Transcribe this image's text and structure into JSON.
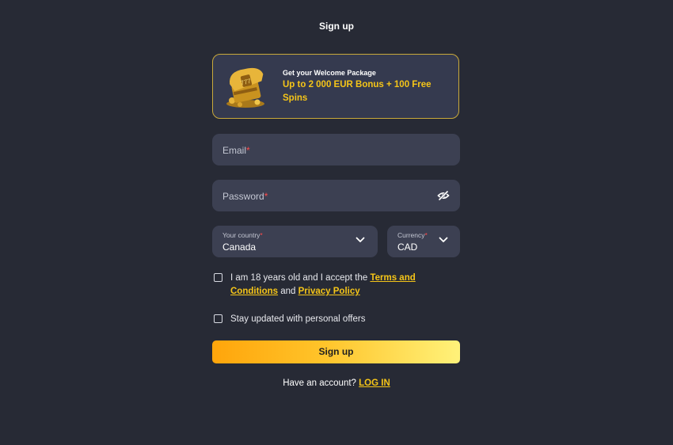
{
  "header": {
    "title": "Sign up"
  },
  "promo": {
    "subtitle": "Get your Welcome Package",
    "offer": "Up to 2 000 EUR Bonus + 100 Free Spins",
    "image_icon": "treasure-chest-icon"
  },
  "form": {
    "email": {
      "label": "Email",
      "required_mark": "*"
    },
    "password": {
      "label": "Password",
      "required_mark": "*",
      "toggle_icon": "eye-off-icon"
    },
    "country": {
      "label": "Your country",
      "required_mark": "*",
      "value": "Canada"
    },
    "currency": {
      "label": "Currency",
      "required_mark": "*",
      "value": "CAD"
    },
    "terms": {
      "text_before": "I am 18 years old and I accept the ",
      "terms_link": "Terms and Conditions",
      "text_middle": " and ",
      "privacy_link": "Privacy Policy",
      "checked": false
    },
    "offers": {
      "text": "Stay updated with personal offers",
      "checked": false
    },
    "submit_label": "Sign up"
  },
  "footer": {
    "question": "Have an account?",
    "login_link": "LOG IN"
  },
  "colors": {
    "background": "#272a35",
    "field": "#3c4052",
    "accent": "#f5c518",
    "required": "#ff4a4a"
  }
}
